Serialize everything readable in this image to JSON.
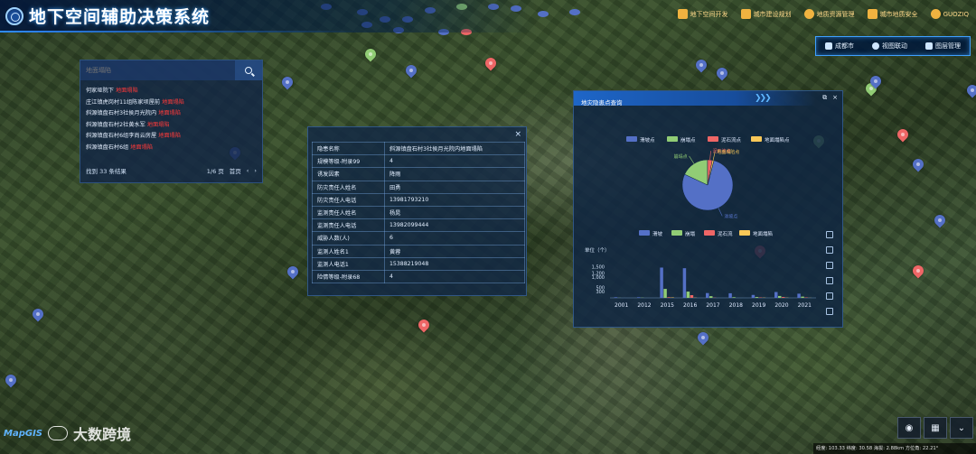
{
  "app": {
    "title": "地下空间辅助决策系统"
  },
  "topnav": [
    {
      "label": "地下空间开发"
    },
    {
      "label": "城市建设规划"
    },
    {
      "label": "地质资源管理"
    },
    {
      "label": "城市地质安全"
    },
    {
      "label": "GUOZIQ"
    }
  ],
  "toolbar": {
    "city_label": "成都市",
    "linkage_label": "视图联动",
    "layer_label": "图层管理"
  },
  "search": {
    "placeholder": "地面塌陷",
    "results": [
      {
        "text": "何家垭院下",
        "tag": "地面塌陷"
      },
      {
        "text": "庄江镇虎岗村11组陈家坝屋前",
        "tag": "地面塌陷"
      },
      {
        "text": "斜源镇盘石村3社侯月光院内",
        "tag": "地面塌陷"
      },
      {
        "text": "斜源镇盘石村2社黄水军",
        "tag": "地面塌陷"
      },
      {
        "text": "斜源镇盘石村6组李尚云房屋",
        "tag": "地面塌陷"
      },
      {
        "text": "斜源镇盘石村6组",
        "tag": "地面塌陷"
      }
    ],
    "total_text": "找到 33 条结果",
    "page_text": "1/6 页",
    "first_label": "首页",
    "prev_label": "‹",
    "next_label": "›"
  },
  "detail": {
    "close_label": "×",
    "rows": [
      {
        "key": "隐患名称",
        "value": "斜源镇盘石村3社侯月光院内地面塌陷"
      },
      {
        "key": "规模等级-附录99",
        "value": "4"
      },
      {
        "key": "诱发因素",
        "value": "降雨"
      },
      {
        "key": "防灾责任人姓名",
        "value": "田勇"
      },
      {
        "key": "防灾责任人电话",
        "value": "13981793210"
      },
      {
        "key": "监测责任人姓名",
        "value": "杨晁"
      },
      {
        "key": "监测责任人电话",
        "value": "13982099444"
      },
      {
        "key": "威胁人数(人)",
        "value": "6"
      },
      {
        "key": "监测人姓名1",
        "value": "黄蓉"
      },
      {
        "key": "监测人电话1",
        "value": "15388219048"
      },
      {
        "key": "险情等级-附录68",
        "value": "4"
      }
    ]
  },
  "stats": {
    "title": "地灾隐患点查询",
    "ctrl_pop": "⧉",
    "ctrl_close": "×"
  },
  "colors": {
    "landslide": "#5470c6",
    "collapse": "#91cc75",
    "debris": "#ee6666",
    "subsidence": "#fac858"
  },
  "chart_data": [
    {
      "type": "pie",
      "legend": [
        "滑坡点",
        "崩塌点",
        "泥石流点",
        "地面塌陷点"
      ],
      "legend_position": "top",
      "values": [
        {
          "name": "滑坡点",
          "value": 78
        },
        {
          "name": "崩塌点",
          "value": 18
        },
        {
          "name": "泥石流点",
          "value": 3
        },
        {
          "name": "地面塌陷点",
          "value": 1
        }
      ]
    },
    {
      "type": "bar",
      "ylabel": "单位（个）",
      "yticks": [
        300,
        500,
        1000,
        1200,
        1500
      ],
      "ylim": [
        0,
        1600
      ],
      "categories": [
        "2001",
        "2012",
        "2015",
        "2016",
        "2017",
        "2018",
        "2019",
        "2020",
        "2021"
      ],
      "legend": [
        "滑坡",
        "崩塌",
        "泥石流",
        "地面塌陷"
      ],
      "series": [
        {
          "name": "滑坡",
          "values": [
            30,
            30,
            1450,
            1420,
            230,
            220,
            140,
            280,
            200
          ]
        },
        {
          "name": "崩塌",
          "values": [
            5,
            10,
            430,
            300,
            80,
            30,
            40,
            90,
            60
          ]
        },
        {
          "name": "泥石流",
          "values": [
            0,
            0,
            30,
            130,
            10,
            0,
            20,
            40,
            20
          ]
        },
        {
          "name": "地面塌陷",
          "values": [
            0,
            0,
            20,
            10,
            0,
            0,
            10,
            10,
            5
          ]
        }
      ]
    }
  ],
  "map_controls": {
    "camera_icon": "camera-icon",
    "layers_icon": "layers-icon",
    "collapse_icon": "chevron-down-icon"
  },
  "status": {
    "text": "经度: 103.33 纬度: 30.58 海拔: 2.88km 方位角: 22.21°"
  },
  "branding": {
    "mapgis": "MapGIS",
    "watermark": "大数跨境"
  }
}
